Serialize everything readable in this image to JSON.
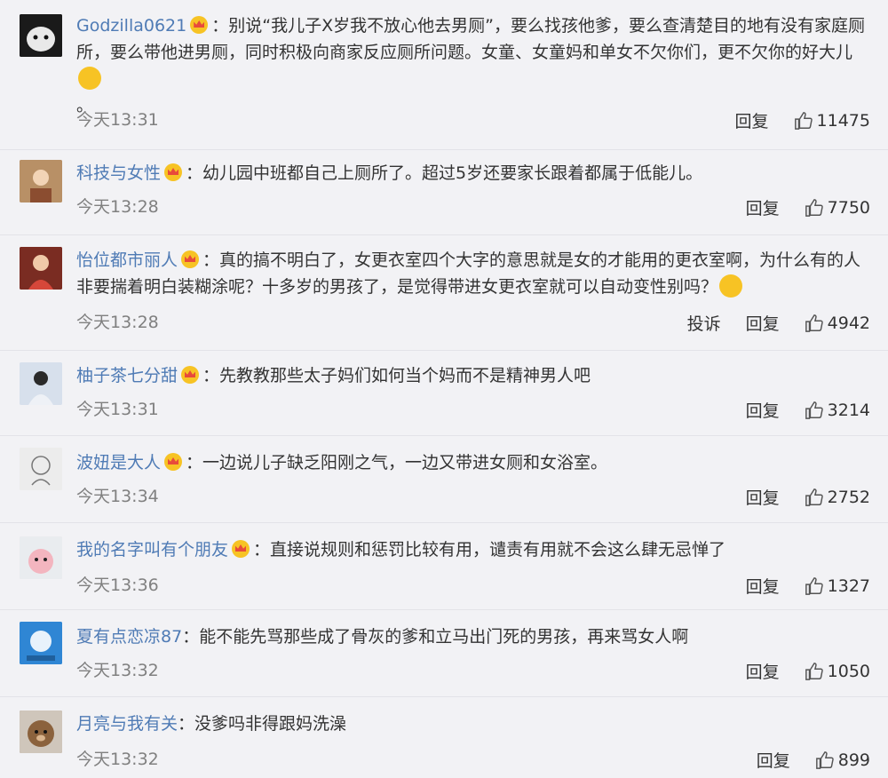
{
  "comments": [
    {
      "user": "Godzilla0621",
      "sep": "：",
      "text": "别说“我儿子X岁我不放心他去男厕”，要么找孩他爹，要么查清楚目的地有没有家庭厕所，要么带他进男厕，同时积极向商家反应厕所问题。女童、女童妈和单女不欠你们，更不欠你的好大儿",
      "emoji": "grinning-emoji",
      "tail": "。",
      "time": "今天13:31",
      "reply": "回复",
      "likes": "11475"
    },
    {
      "user": "科技与女性",
      "sep": "：",
      "text": "幼儿园中班都自己上厕所了。超过5岁还要家长跟着都属于低能儿。",
      "time": "今天13:28",
      "reply": "回复",
      "likes": "7750"
    },
    {
      "user": "怡位都市丽人",
      "sep": "：",
      "text": "真的搞不明白了，女更衣室四个大字的意思就是女的才能用的更衣室啊，为什么有的人非要揣着明白装糊涂呢？十多岁的男孩了，是觉得带进女更衣室就可以自动变性别吗？",
      "emoji": "thinking-emoji",
      "time": "今天13:28",
      "report": "投诉",
      "reply": "回复",
      "likes": "4942"
    },
    {
      "user": "柚子茶七分甜",
      "sep": "：",
      "text": "先教教那些太子妈们如何当个妈而不是精神男人吧",
      "time": "今天13:31",
      "reply": "回复",
      "likes": "3214"
    },
    {
      "user": "波妞是大人",
      "sep": "：",
      "text": "一边说儿子缺乏阳刚之气，一边又带进女厕和女浴室。",
      "time": "今天13:34",
      "reply": "回复",
      "likes": "2752"
    },
    {
      "user": "我的名字叫有个朋友",
      "sep": "：",
      "text": "直接说规则和惩罚比较有用，谴责有用就不会这么肆无忌惮了",
      "time": "今天13:36",
      "reply": "回复",
      "likes": "1327"
    },
    {
      "user": "夏有点恋凉87",
      "sep": "：",
      "text": "能不能先骂那些成了骨灰的爹和立马出门死的男孩，再来骂女人啊",
      "time": "今天13:32",
      "reply": "回复",
      "likes": "1050"
    },
    {
      "user": "月亮与我有关",
      "sep": "：",
      "text": "没爹吗非得跟妈洗澡",
      "time": "今天13:32",
      "reply": "回复",
      "likes": "899"
    }
  ],
  "colors": {
    "username": "#4f7bb5",
    "time": "#808080",
    "background": "#f2f2f5",
    "vip_crown": "#f7c324"
  }
}
